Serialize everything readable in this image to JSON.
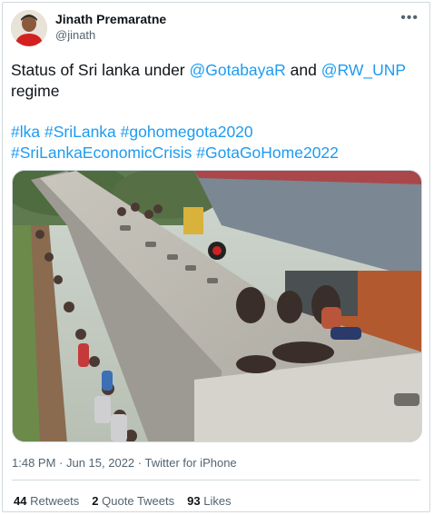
{
  "author": {
    "name": "Jinath Premaratne",
    "handle": "@jinath"
  },
  "tweet": {
    "text_prefix": "Status of Sri lanka under ",
    "mention1": "@GotabayaR",
    "text_mid": " and ",
    "mention2": "@RW_UNP",
    "text_suffix": "regime",
    "hashtags": [
      "#lka",
      "#SriLanka",
      "#gohomegota2020",
      "#SriLankaEconomicCrisis",
      "#GotaGoHome2022"
    ]
  },
  "meta": {
    "time": "1:48 PM",
    "separator": " · ",
    "date": "Jun 15, 2022",
    "source": "Twitter for iPhone"
  },
  "stats": {
    "retweets_count": "44",
    "retweets_label": "Retweets",
    "quotes_count": "2",
    "quotes_label": "Quote Tweets",
    "likes_count": "93",
    "likes_label": "Likes"
  },
  "icons": {
    "more": "more-icon"
  },
  "colors": {
    "link": "#1d9bf0",
    "secondary_text": "#536471",
    "border": "#cfd9de"
  }
}
